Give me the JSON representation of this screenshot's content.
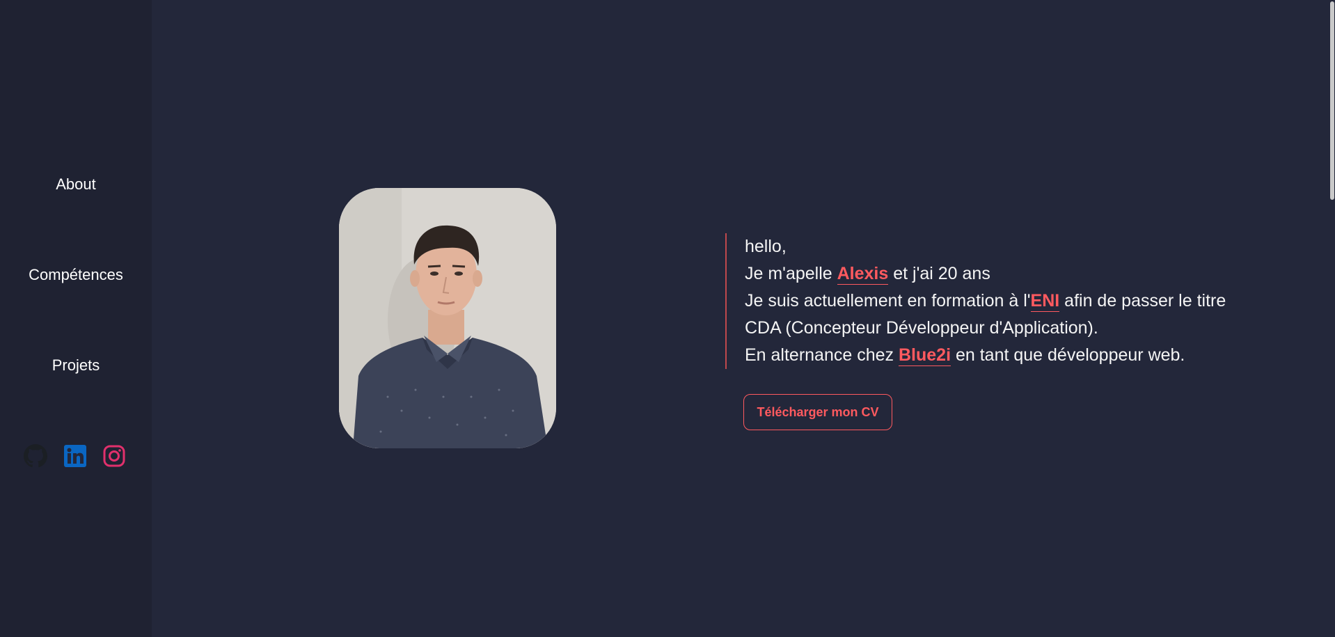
{
  "nav": {
    "items": [
      {
        "label": "About"
      },
      {
        "label": "Compétences"
      },
      {
        "label": "Projets"
      }
    ]
  },
  "socials": [
    {
      "icon": "github-icon",
      "color": "#1b1f24"
    },
    {
      "icon": "linkedin-icon",
      "color": "#0a66c2"
    },
    {
      "icon": "instagram-icon",
      "color": "#e1306c"
    }
  ],
  "intro": {
    "greeting": "hello,",
    "line2_pre": "Je m'apelle ",
    "name": "Alexis",
    "line2_post": " et j'ai 20 ans",
    "line3_pre": "Je suis actuellement en formation à l'",
    "school": "ENI",
    "line3_post": " afin de passer le titre",
    "line4": "CDA (Concepteur Développeur d'Application).",
    "line5_pre": "En alternance chez ",
    "company": "Blue2i",
    "line5_post": " en tant que développeur web."
  },
  "cv_button": {
    "label": "Télécharger mon CV"
  },
  "colors": {
    "accent": "#ff5a5f",
    "background": "#23273a",
    "sidebar": "#1f2232"
  }
}
